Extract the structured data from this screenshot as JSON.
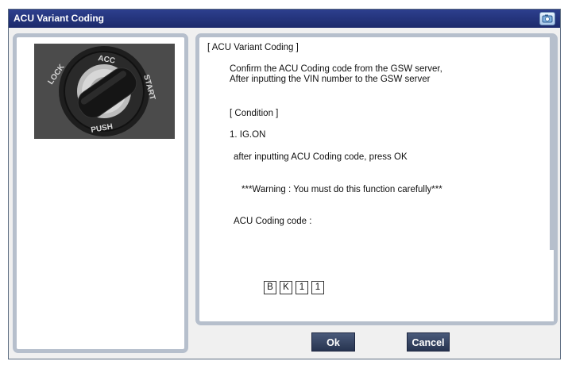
{
  "window": {
    "title": "ACU Variant Coding"
  },
  "content": {
    "heading": "[ ACU Variant Coding ]",
    "line1": "Confirm the ACU Coding code from the GSW server,",
    "line2": "After inputting the VIN number to the GSW server",
    "condition_heading": "[ Condition ]",
    "condition_item": "1. IG.ON",
    "instruction": "after inputting ACU Coding code, press OK",
    "warning": "***Warning : You must do this function carefully***",
    "code_label": "ACU Coding code :",
    "code_chars": [
      "B",
      "K",
      "1",
      "1"
    ]
  },
  "ignition_image": {
    "ring_labels": [
      "LOCK",
      "ACC",
      "START",
      "PUSH"
    ]
  },
  "buttons": {
    "ok": "Ok",
    "cancel": "Cancel"
  },
  "icons": {
    "help": "help-icon"
  },
  "colors": {
    "title_bar": "#22337a",
    "panel_border": "#b6bfcc",
    "button": "#34425f"
  }
}
